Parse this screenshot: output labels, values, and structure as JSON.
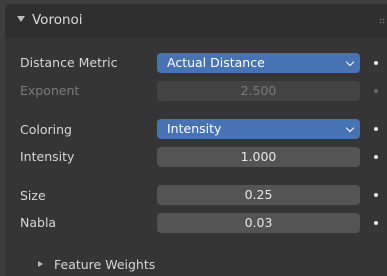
{
  "panel": {
    "title": "Voronoi"
  },
  "rows": {
    "distance_metric": {
      "label": "Distance Metric",
      "value": "Actual Distance"
    },
    "exponent": {
      "label": "Exponent",
      "value": "2.500"
    },
    "coloring": {
      "label": "Coloring",
      "value": "Intensity"
    },
    "intensity": {
      "label": "Intensity",
      "value": "1.000"
    },
    "size": {
      "label": "Size",
      "value": "0.25"
    },
    "nabla": {
      "label": "Nabla",
      "value": "0.03"
    }
  },
  "subpanel": {
    "title": "Feature Weights"
  },
  "colors": {
    "accent": "#4772b3",
    "panel_bg": "#353535",
    "field_bg": "#545454"
  }
}
